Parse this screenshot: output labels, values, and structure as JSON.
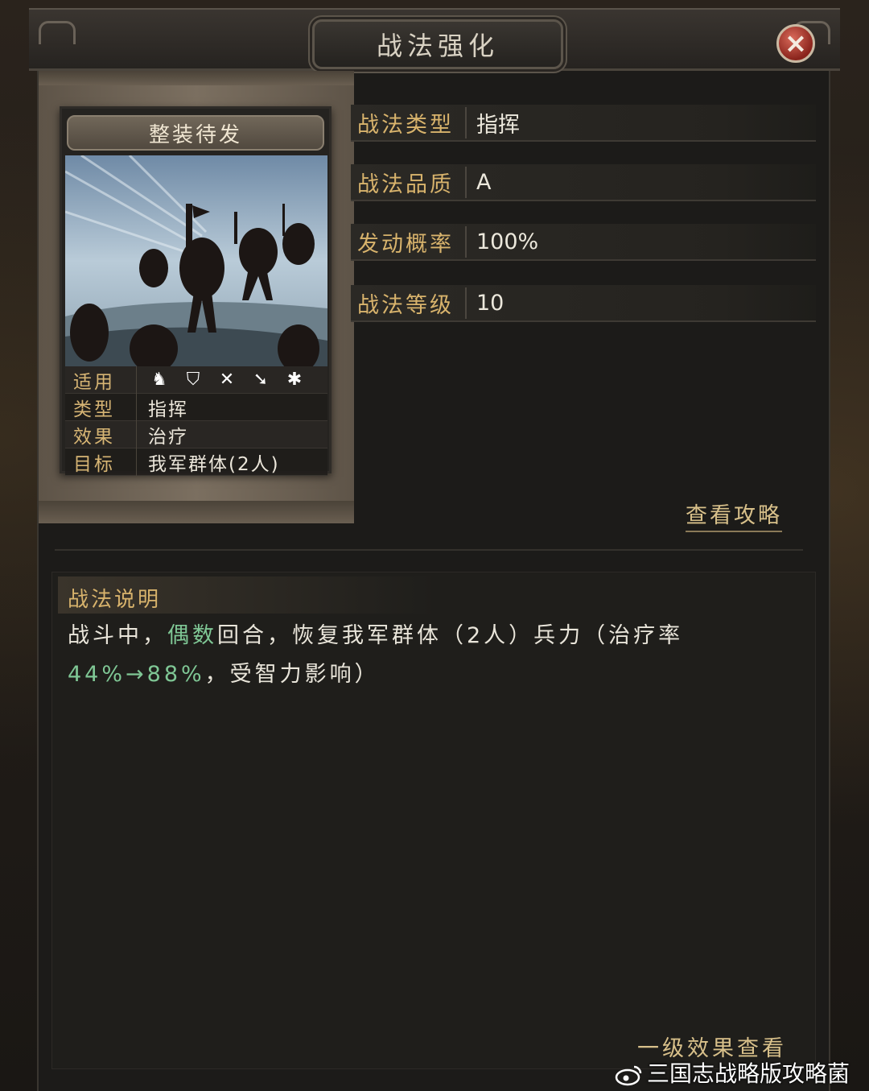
{
  "window": {
    "title": "战法强化",
    "close_icon": "×"
  },
  "card": {
    "name": "整装待发",
    "stats": [
      {
        "label": "适用",
        "icons": [
          "cavalry-icon",
          "shield-icon",
          "bow-icon",
          "spear-icon",
          "wheel-icon"
        ]
      },
      {
        "label": "类型",
        "value": "指挥"
      },
      {
        "label": "效果",
        "value": "治疗"
      },
      {
        "label": "目标",
        "value": "我军群体(2人)"
      }
    ]
  },
  "info": {
    "type": {
      "label": "战法类型",
      "value": "指挥"
    },
    "quality": {
      "label": "战法品质",
      "value": "A"
    },
    "rate": {
      "label": "发动概率",
      "value": "100%"
    },
    "level": {
      "label": "战法等级",
      "value": "10"
    }
  },
  "guide_link": "查看攻略",
  "description": {
    "header": "战法说明",
    "part1": "战斗中，",
    "highlight1": "偶数",
    "part2": "回合，恢复我军群体（2人）兵力（治疗率",
    "highlight2": "44%→88%",
    "part3": "，受智力影响）"
  },
  "level_effect_link": "一级效果查看",
  "watermark": "三国志战略版攻略菌",
  "colors": {
    "accent_gold": "#d8b36c",
    "highlight_green": "#7fc795",
    "close_red": "#8a241c"
  }
}
